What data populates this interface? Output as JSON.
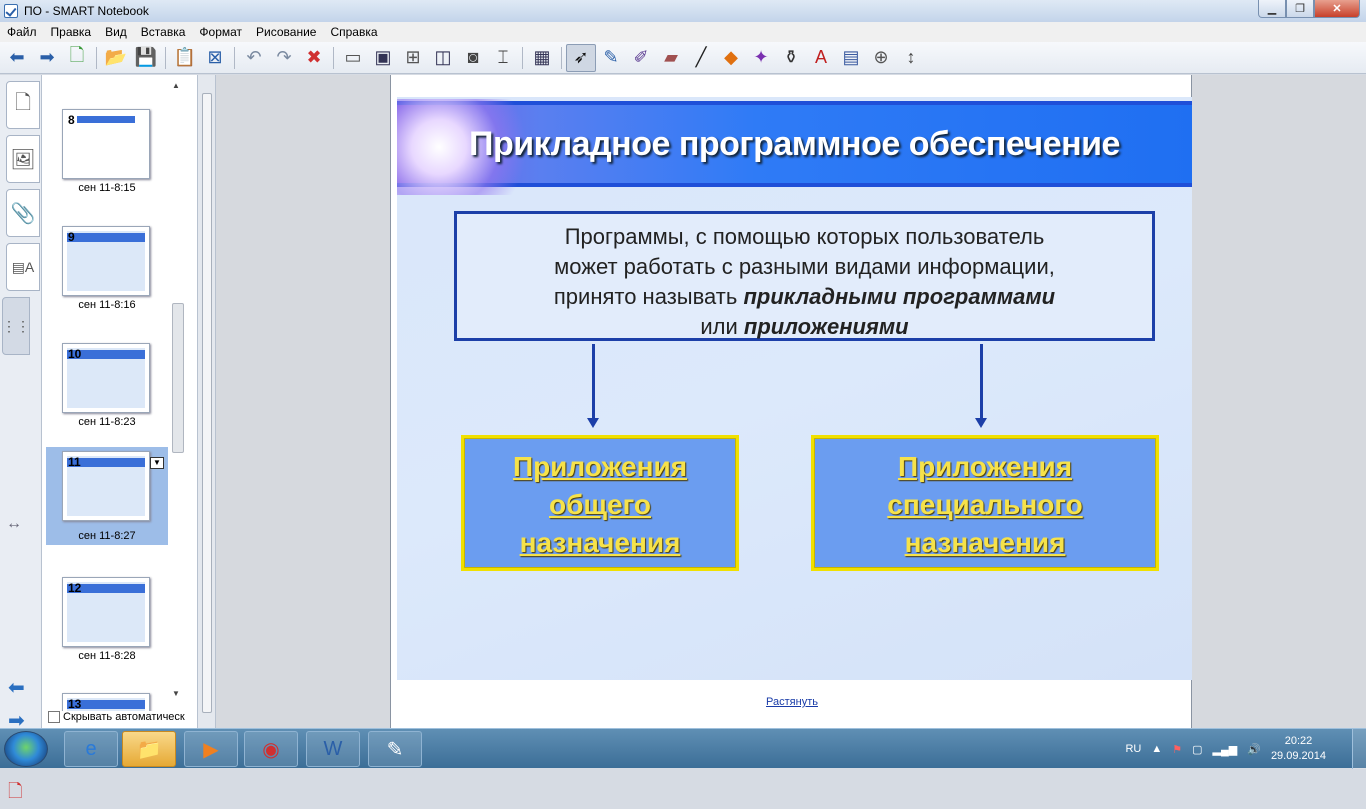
{
  "window": {
    "title": "ПО - SMART Notebook"
  },
  "menubar": {
    "items": [
      "Файл",
      "Правка",
      "Вид",
      "Вставка",
      "Формат",
      "Рисование",
      "Справка"
    ]
  },
  "toolbar": {
    "icons": [
      "back-arrow-icon",
      "forward-arrow-icon",
      "add-page-icon",
      "open-folder-icon",
      "save-icon",
      "paste-icon",
      "delete-page-icon",
      "undo-icon",
      "redo-icon",
      "delete-icon",
      "screen-shade-icon",
      "full-screen-icon",
      "transparent-bg-icon",
      "dual-page-icon",
      "screen-capture-icon",
      "document-camera-icon",
      "table-icon",
      "select-icon",
      "pen-icon",
      "creative-pen-icon",
      "eraser-icon",
      "line-icon",
      "shapes-icon",
      "magic-pen-icon",
      "fill-icon",
      "text-icon",
      "properties-icon",
      "measurement-icon",
      "move-toolbar-icon"
    ]
  },
  "pages": [
    {
      "num": "8",
      "caption": "сен 11-8:15",
      "selected": false
    },
    {
      "num": "9",
      "caption": "сен 11-8:16",
      "selected": false
    },
    {
      "num": "10",
      "caption": "сен 11-8:23",
      "selected": false
    },
    {
      "num": "11",
      "caption": "сен 11-8:27",
      "selected": true
    },
    {
      "num": "12",
      "caption": "сен 11-8:28",
      "selected": false
    },
    {
      "num": "13",
      "caption": "",
      "selected": false
    }
  ],
  "sidebar": {
    "autohide_label": "Скрывать автоматическ"
  },
  "slide": {
    "title": "Прикладное программное  обеспечение",
    "definition": {
      "line1": "Программы, с помощью которых пользователь",
      "line2": "может работать с разными видами информации,",
      "line3_plain": "принято называть ",
      "line3_bold": "прикладными программами",
      "line4_plain": "или ",
      "line4_bold": "приложениями"
    },
    "categories": [
      {
        "line1": "Приложения",
        "line2": "общего",
        "line3": "назначения"
      },
      {
        "line1": "Приложения",
        "line2": "специального",
        "line3": "назначения"
      }
    ]
  },
  "canvas": {
    "stretch_link": "Растянуть"
  },
  "taskbar": {
    "lang": "RU",
    "time": "20:22",
    "date": "29.09.2014"
  }
}
